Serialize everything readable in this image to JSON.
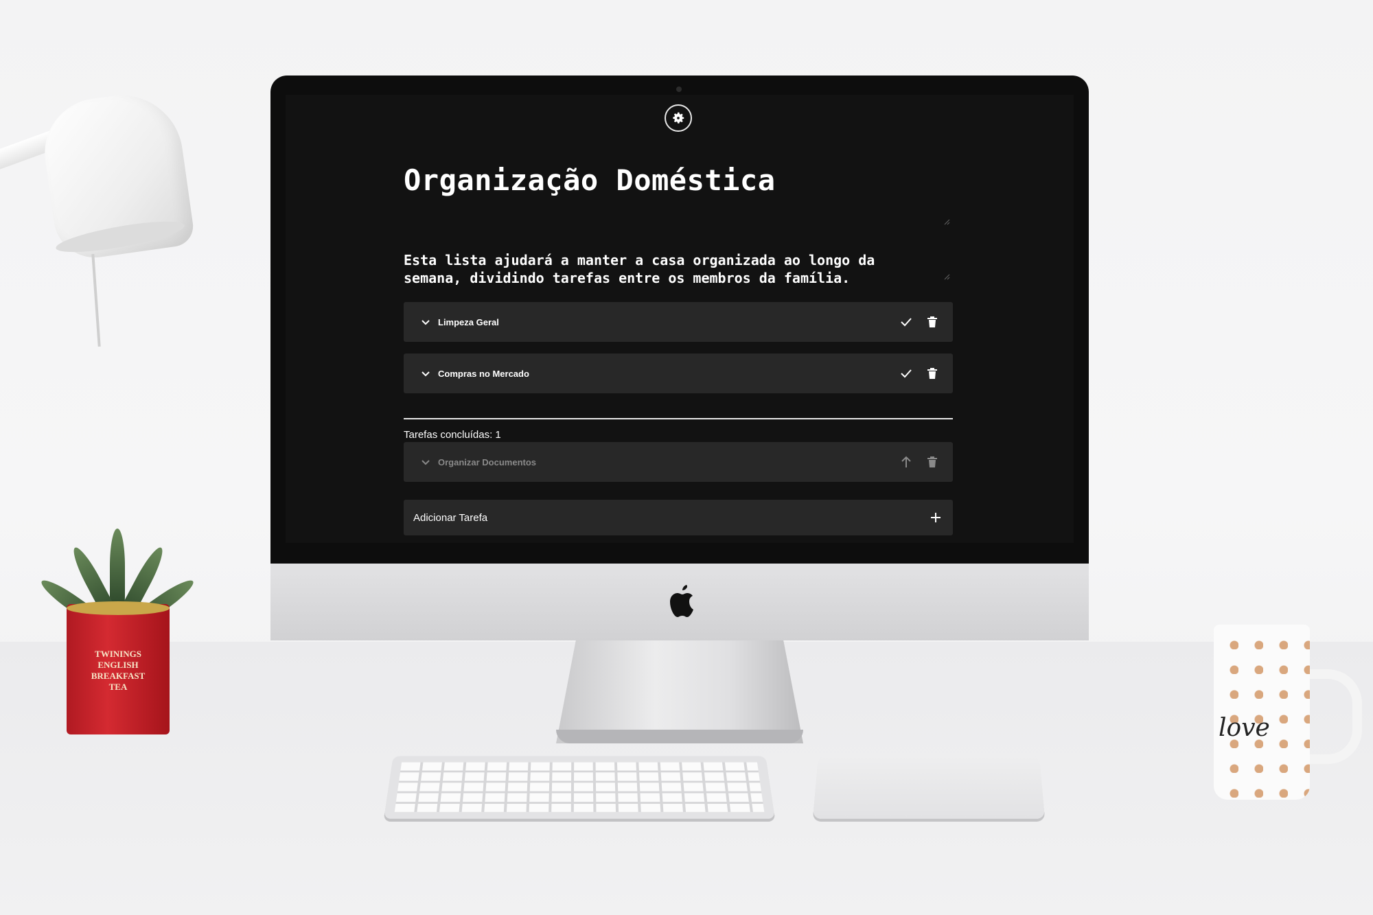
{
  "app": {
    "title": "Organização Doméstica",
    "description": "Esta lista ajudará a manter a casa organizada ao longo da semana, dividindo tarefas entre os membros da família.",
    "settings_icon": "gear-icon",
    "tasks": [
      {
        "label": "Limpeza Geral",
        "completed": false,
        "icons": [
          "chevron-down-icon",
          "check-icon",
          "trash-icon"
        ]
      },
      {
        "label": "Compras no Mercado",
        "completed": false,
        "icons": [
          "chevron-down-icon",
          "check-icon",
          "trash-icon"
        ]
      }
    ],
    "completed_section": {
      "count_text": "Tarefas concluídas: 1",
      "tasks": [
        {
          "label": "Organizar Documentos",
          "completed": true,
          "icons": [
            "chevron-down-icon",
            "arrow-up-icon",
            "trash-icon"
          ]
        }
      ]
    },
    "add_button": {
      "label": "Adicionar Tarefa",
      "icon": "plus-icon"
    }
  },
  "scene": {
    "tin_label": "TWININGS ENGLISH BREAKFAST TEA",
    "mug_text": "love"
  },
  "colors": {
    "screen_bg": "#121212",
    "card_bg": "#282828",
    "text": "#ffffff",
    "muted_text": "#8a8a8a"
  }
}
